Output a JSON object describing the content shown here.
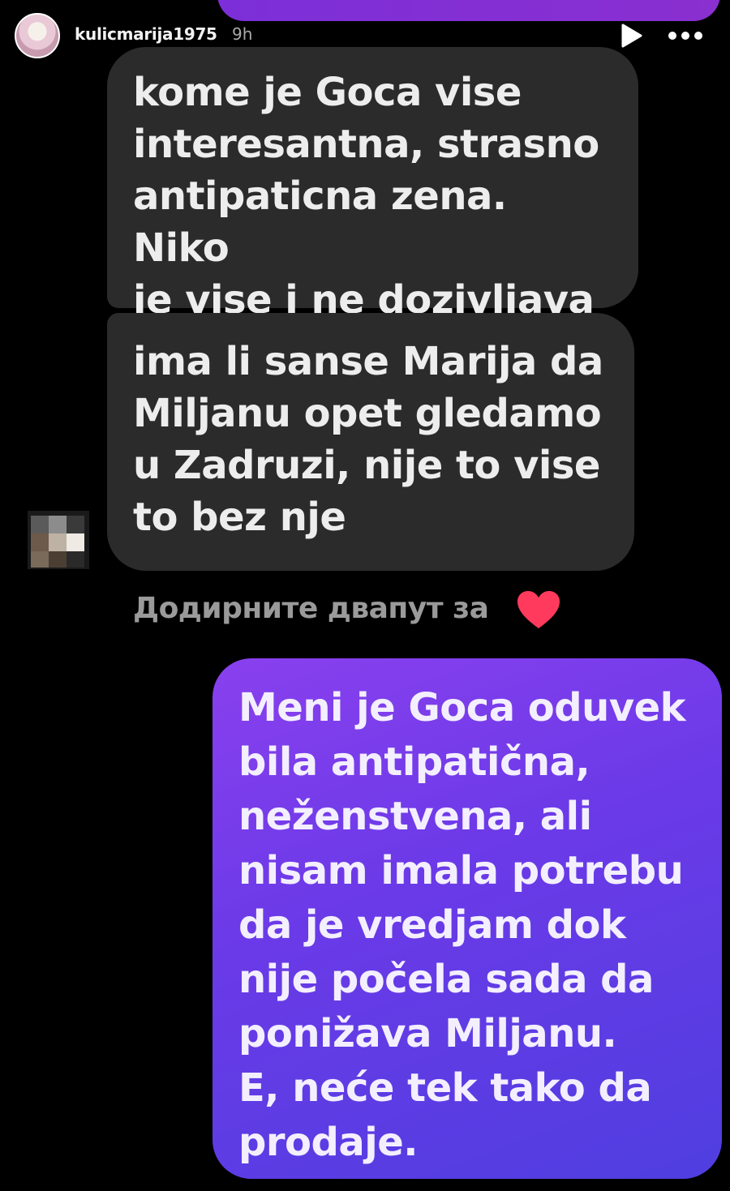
{
  "header": {
    "username": "kulicmarija1975",
    "time_ago": "9h",
    "play_icon": "play-icon",
    "more_icon": "more-options-icon"
  },
  "messages": {
    "incoming": [
      {
        "text": "kome je Goca vise\ninteresantna, strasno\nantipaticna zena. Niko\nje vise i ne dozivljava"
      },
      {
        "text": "ima li sanse Marija da\nMiljanu opet gledamo\nu Zadruzi, nije to vise\nto bez nje"
      }
    ],
    "double_tap_hint": "Додирните двапут за",
    "heart_icon": "heart-icon",
    "outgoing": {
      "text": "Meni je Goca oduvek\nbila antipatična,\nneženstvena, ali\nnisam imala potrebu\nda je vredjam dok\nnije počela sada da\nponižava Miljanu.\nE, neće tek tako da\nprodaje."
    }
  },
  "colors": {
    "background": "#000000",
    "incoming_bubble": "#2b2b2b",
    "outgoing_gradient_start": "#8a40ee",
    "outgoing_gradient_end": "#4f3ee0",
    "heart": "#ff3a5c"
  }
}
